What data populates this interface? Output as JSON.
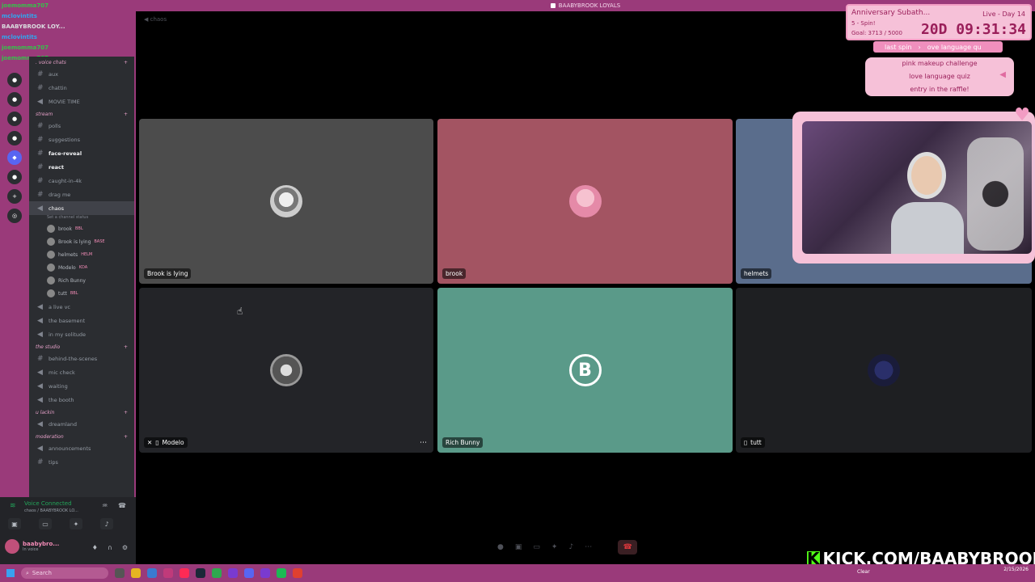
{
  "window": {
    "title": "BAABYBROOK LOYALS"
  },
  "chat_overlay": [
    {
      "user": "joemomma707",
      "color": "#36c24a"
    },
    {
      "user": "mclovintits",
      "color": "#2fa8f0"
    },
    {
      "user": "BAABYBROOK LOY...",
      "color": "#dbdee1"
    },
    {
      "user": "mclovintits",
      "color": "#2fa8f0"
    },
    {
      "user": "joemomma707",
      "color": "#36c24a"
    },
    {
      "user": "joemomma707",
      "color": "#36c24a"
    }
  ],
  "sidebar": {
    "sections": [
      {
        "category": ". voice chats",
        "channels": [
          {
            "name": "aux",
            "kind": "voice"
          },
          {
            "name": "chattin",
            "kind": "text"
          },
          {
            "name": "MOVIE TIME",
            "kind": "voice"
          }
        ]
      },
      {
        "category": "stream",
        "channels": [
          {
            "name": "polls",
            "kind": "text"
          },
          {
            "name": "suggestions",
            "kind": "text"
          },
          {
            "name": "face-reveal",
            "kind": "text",
            "bold": true
          },
          {
            "name": "react",
            "kind": "text",
            "bold": true
          },
          {
            "name": "caught-in-4k",
            "kind": "text"
          },
          {
            "name": "drag me",
            "kind": "text"
          },
          {
            "name": "chaos",
            "kind": "voice",
            "active": true
          }
        ]
      }
    ],
    "chaos_status": "Set a channel status",
    "voice_users": [
      {
        "name": "brook",
        "tag": "BBL"
      },
      {
        "name": "Brook is lying",
        "tag": "BASE"
      },
      {
        "name": "helmets",
        "tag": "HELM"
      },
      {
        "name": "Modelo",
        "tag": "KDA"
      },
      {
        "name": "Rich Bunny",
        "tag": ""
      },
      {
        "name": "tutt",
        "tag": "BBL"
      }
    ],
    "more_channels": [
      {
        "name": "a live vc",
        "kind": "voice"
      },
      {
        "name": "the basement",
        "kind": "voice"
      },
      {
        "name": "in my solitude",
        "kind": "voice"
      }
    ],
    "studio_category": "the studio",
    "studio_channels": [
      {
        "name": "behind-the-scenes",
        "kind": "text"
      },
      {
        "name": "mic check",
        "kind": "voice"
      },
      {
        "name": "waiting",
        "kind": "voice"
      },
      {
        "name": "the booth",
        "kind": "voice"
      }
    ],
    "lackin_category": "u lackin",
    "lackin_channels": [
      {
        "name": "dreamland",
        "kind": "voice"
      }
    ],
    "moderation_category": "moderation",
    "moderation_channels": [
      {
        "name": "announcements",
        "kind": "voice"
      },
      {
        "name": "tips",
        "kind": "text"
      }
    ]
  },
  "voice_panel": {
    "title": "Voice Connected",
    "subtitle": "chaos / BAABYBROOK LO...",
    "username": "baabybro...",
    "user_status": "In voice"
  },
  "call": {
    "channel": "chaos",
    "tiles": [
      {
        "label": "Brook is lying"
      },
      {
        "label": "brook"
      },
      {
        "label": "helmets"
      },
      {
        "label": "Modelo"
      },
      {
        "label": "Rich Bunny",
        "initial": "B"
      },
      {
        "label": "tutt"
      }
    ]
  },
  "overlay": {
    "sub_title": "Anniversary Subath...",
    "sub_line1": "5 - Spin!",
    "sub_goal": "Goal: 3713 / 5000",
    "live_day": "Live - Day 14",
    "timer": "20D 09:31:34",
    "last_spin_label": "last spin",
    "last_spin_value": "ove language qu",
    "list": [
      "pink makeup challenge",
      "love language quiz",
      "entry in the raffle!"
    ],
    "kick_url": "KICK.COM/BAABYBROOK"
  },
  "taskbar": {
    "search_placeholder": "Search",
    "weather": "Clear",
    "date": "2/15/2026"
  }
}
